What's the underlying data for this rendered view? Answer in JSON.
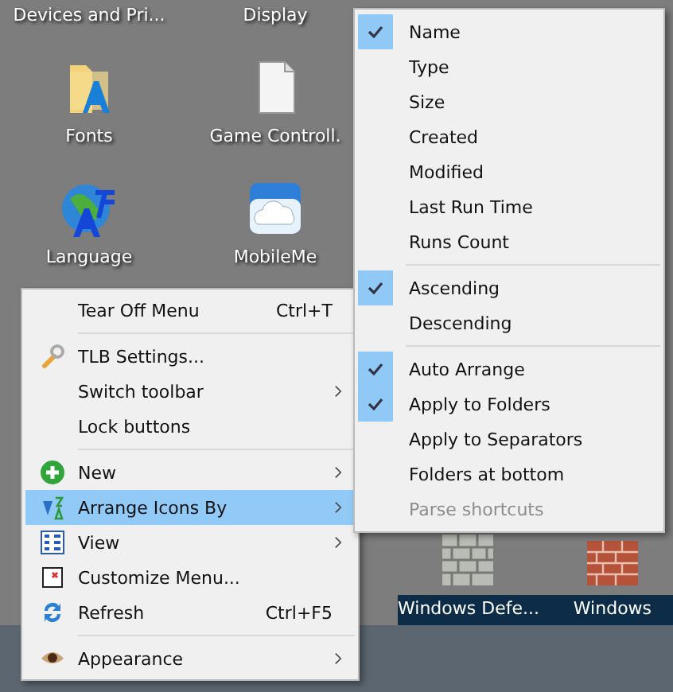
{
  "desktop": {
    "icons": [
      {
        "label": "Devices and Pri...",
        "kind": "none"
      },
      {
        "label": "Display",
        "kind": "none"
      },
      {
        "label": "Fonts",
        "kind": "fonts"
      },
      {
        "label": "Game Controll.",
        "kind": "document"
      },
      {
        "label": "Language",
        "kind": "globe"
      },
      {
        "label": "MobileMe",
        "kind": "cloud"
      }
    ],
    "strip_icons": [
      {
        "label": "Windows Defe...",
        "kind": "graywall"
      },
      {
        "label": "Windows",
        "kind": "brickwall"
      }
    ]
  },
  "menu": {
    "items": [
      {
        "kind": "item",
        "label": "Tear Off Menu",
        "shortcut": "Ctrl+T",
        "submenu": false,
        "selected": false
      },
      {
        "kind": "separator"
      },
      {
        "kind": "item",
        "label": "TLB Settings...",
        "submenu": false,
        "selected": false
      },
      {
        "kind": "item",
        "label": "Switch toolbar",
        "submenu": true,
        "selected": false
      },
      {
        "kind": "item",
        "label": "Lock buttons",
        "submenu": false,
        "selected": false
      },
      {
        "kind": "separator"
      },
      {
        "kind": "item",
        "label": "New",
        "submenu": true,
        "selected": false
      },
      {
        "kind": "item",
        "label": "Arrange Icons By",
        "submenu": true,
        "selected": true
      },
      {
        "kind": "item",
        "label": "View",
        "submenu": true,
        "selected": false
      },
      {
        "kind": "item",
        "label": "Customize Menu...",
        "submenu": false,
        "selected": false
      },
      {
        "kind": "item",
        "label": "Refresh",
        "shortcut": "Ctrl+F5",
        "submenu": false,
        "selected": false
      },
      {
        "kind": "separator"
      },
      {
        "kind": "item",
        "label": "Appearance",
        "submenu": true,
        "selected": false
      }
    ]
  },
  "submenu": {
    "items": [
      {
        "kind": "item",
        "label": "Name",
        "checked": true,
        "disabled": false
      },
      {
        "kind": "item",
        "label": "Type",
        "checked": false,
        "disabled": false
      },
      {
        "kind": "item",
        "label": "Size",
        "checked": false,
        "disabled": false
      },
      {
        "kind": "item",
        "label": "Created",
        "checked": false,
        "disabled": false
      },
      {
        "kind": "item",
        "label": "Modified",
        "checked": false,
        "disabled": false
      },
      {
        "kind": "item",
        "label": "Last Run Time",
        "checked": false,
        "disabled": false
      },
      {
        "kind": "item",
        "label": "Runs Count",
        "checked": false,
        "disabled": false
      },
      {
        "kind": "separator"
      },
      {
        "kind": "item",
        "label": "Ascending",
        "checked": true,
        "disabled": false
      },
      {
        "kind": "item",
        "label": "Descending",
        "checked": false,
        "disabled": false
      },
      {
        "kind": "separator"
      },
      {
        "kind": "item",
        "label": "Auto Arrange",
        "checked": true,
        "disabled": false
      },
      {
        "kind": "item",
        "label": "Apply to Folders",
        "checked": true,
        "disabled": false
      },
      {
        "kind": "item",
        "label": "Apply to Separators",
        "checked": false,
        "disabled": false
      },
      {
        "kind": "item",
        "label": "Folders at bottom",
        "checked": false,
        "disabled": false
      },
      {
        "kind": "item",
        "label": "Parse shortcuts",
        "checked": false,
        "disabled": true
      }
    ]
  }
}
